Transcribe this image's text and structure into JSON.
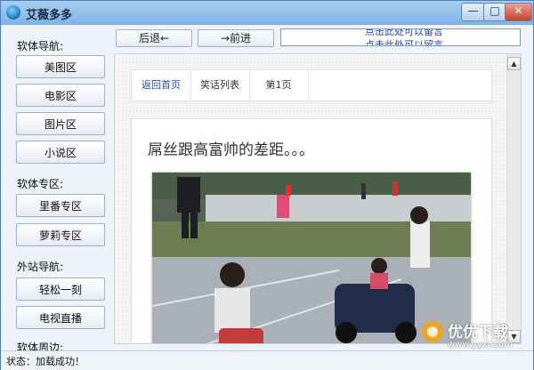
{
  "window": {
    "title": "艾薇多多",
    "min_label": "—",
    "max_label": "□",
    "close_label": "✕"
  },
  "sidebar": {
    "sections": [
      {
        "label": "软体导航:",
        "items": [
          "美图区",
          "电影区",
          "图片区",
          "小说区"
        ]
      },
      {
        "label": "软体专区:",
        "items": [
          "里番专区",
          "萝莉专区"
        ]
      },
      {
        "label": "外站导航:",
        "items": [
          "轻松一刻",
          "电视直播"
        ]
      },
      {
        "label": "软体周边:",
        "items": []
      }
    ]
  },
  "toolbar": {
    "back_label": "后退←",
    "forward_label": "→前进",
    "marquee_line1": "点击此处可以留言",
    "marquee_line2": "点击此处可以留言"
  },
  "browser": {
    "tabs": [
      "返回首页",
      "笑话列表",
      "第1页"
    ],
    "post_title": "屌丝跟高富帅的差距。。。",
    "scroll_up": "▲",
    "scroll_down": "▼"
  },
  "status": {
    "text": "状态：加载成功！"
  },
  "watermark": {
    "line1": "优优下载",
    "line2": "www.yyxt.com"
  },
  "colors": {
    "accent": "#1d4fbf",
    "titlebar": "#7db3e6",
    "close": "#c5432a"
  }
}
